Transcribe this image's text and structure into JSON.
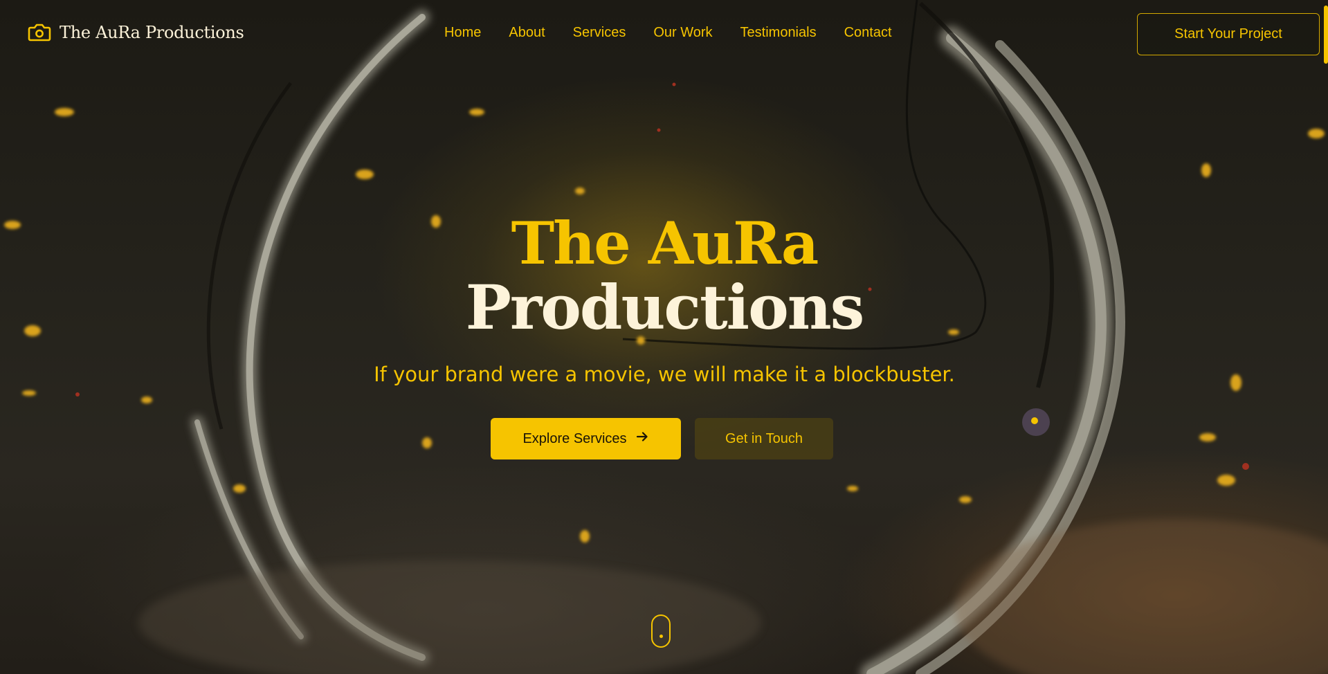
{
  "brand": {
    "name": "The AuRa Productions",
    "icon": "camera-icon"
  },
  "nav": {
    "items": [
      {
        "label": "Home"
      },
      {
        "label": "About"
      },
      {
        "label": "Services"
      },
      {
        "label": "Our Work"
      },
      {
        "label": "Testimonials"
      },
      {
        "label": "Contact"
      }
    ],
    "cta_label": "Start Your Project"
  },
  "hero": {
    "title_line1": "The AuRa",
    "title_line2": "Productions",
    "tagline": "If your brand were a movie, we will make it a blockbuster.",
    "primary_button": "Explore Services",
    "primary_button_icon": "arrow-right-icon",
    "secondary_button": "Get in Touch"
  },
  "scroll_indicator": {
    "icon": "mouse-scroll-icon"
  },
  "colors": {
    "accent": "#f6c400",
    "cream": "#fdf3da",
    "background": "#1c1a14"
  }
}
